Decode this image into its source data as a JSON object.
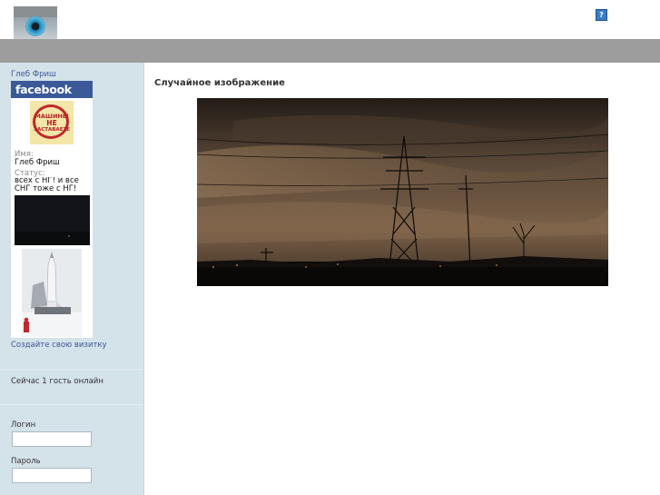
{
  "header": {
    "logo_icon": "eye-logo-icon",
    "help_label": "?"
  },
  "sidebar": {
    "facebook": {
      "profile_link": "Глеб Фриш",
      "brand": "facebook",
      "avatar_text_top": "МАШИНЫ",
      "avatar_text_mid": "НЕ",
      "avatar_text_bottom": "ЗАСТАВАЕТЕ",
      "name_label": "Имя:",
      "name_value": "Глеб Фриш",
      "status_label": "Статус:",
      "status_value": "всех с НГ! и все СНГ тоже с НГ!"
    },
    "create_card_link": "Создайте свою визитку",
    "online_text": "Сейчас 1 гость онлайн",
    "login": {
      "login_label": "Логин",
      "password_label": "Пароль"
    }
  },
  "main": {
    "title": "Случайное изображение",
    "image_icon": "night-power-lines-photo"
  },
  "colors": {
    "band": "#9d9d9d",
    "sidebar_bg": "#d4e2ea",
    "facebook_blue": "#3b5998",
    "link": "#3b5998"
  }
}
